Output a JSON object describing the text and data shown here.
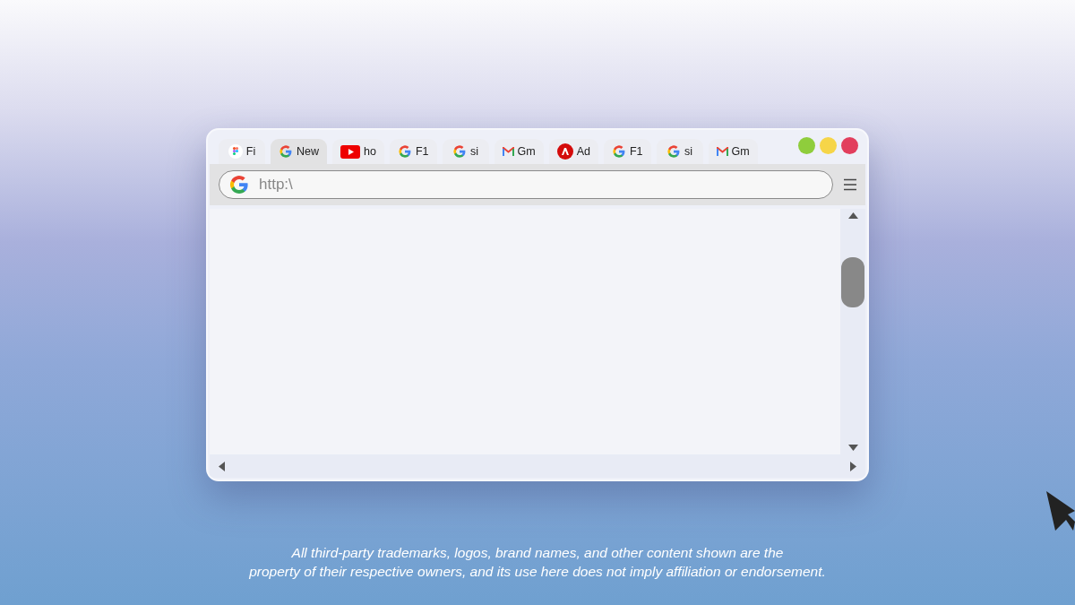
{
  "browser": {
    "tabs": [
      {
        "kind": "figma",
        "label": "Fi",
        "selected": false
      },
      {
        "kind": "google",
        "label": "New",
        "selected": true
      },
      {
        "kind": "youtube",
        "label": "ho",
        "selected": false
      },
      {
        "kind": "google",
        "label": "F1",
        "selected": false
      },
      {
        "kind": "google",
        "label": "si",
        "selected": false
      },
      {
        "kind": "gmail",
        "label": "Gm",
        "selected": false
      },
      {
        "kind": "adobe",
        "label": "Ad",
        "selected": false
      },
      {
        "kind": "google",
        "label": "F1",
        "selected": false
      },
      {
        "kind": "google",
        "label": "si",
        "selected": false
      },
      {
        "kind": "gmail",
        "label": "Gm",
        "selected": false
      }
    ],
    "window_controls": [
      {
        "color": "#8fcd3c"
      },
      {
        "color": "#f6d548"
      },
      {
        "color": "#e23e5d"
      }
    ],
    "address_bar": {
      "value": "http:\\"
    }
  },
  "disclaimer": [
    "All third-party trademarks, logos, brand names, and other content shown are the",
    "property of their respective owners, and its use here does not imply affiliation or endorsement."
  ]
}
